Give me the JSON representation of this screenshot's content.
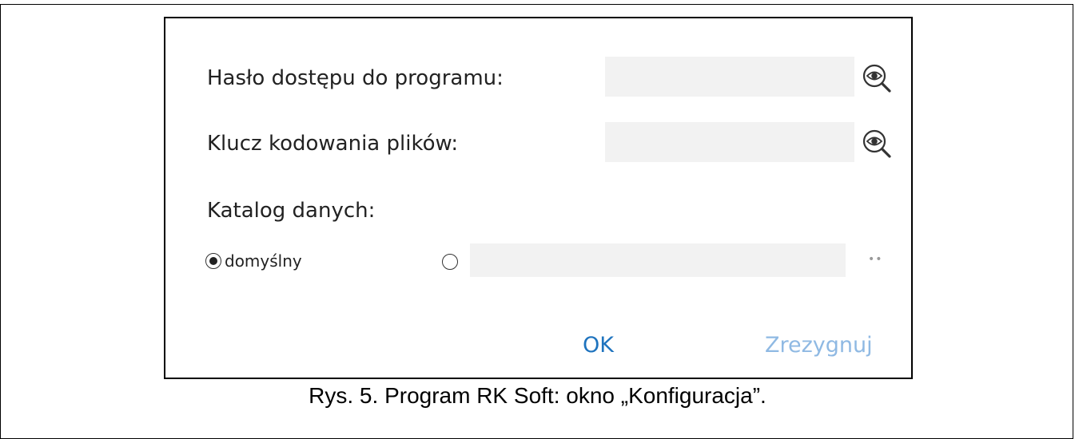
{
  "dialog": {
    "password": {
      "label": "Hasło dostępu do programu:",
      "value": "",
      "reveal_icon": "eye-magnifier-icon"
    },
    "encryption_key": {
      "label": "Klucz kodowania plików:",
      "value": "",
      "reveal_icon": "eye-magnifier-icon"
    },
    "data_directory": {
      "label": "Katalog danych:",
      "default_option_label": "domyślny",
      "default_selected": true,
      "custom_path_value": "",
      "browse_label": "••"
    },
    "ok_label": "OK",
    "cancel_label": "Zrezygnuj",
    "colors": {
      "ok": "#1e73be",
      "cancel": "#8fb9e3",
      "field_background": "#f2f2f2"
    }
  },
  "caption": "Rys. 5. Program RK Soft: okno „Konfiguracja”."
}
